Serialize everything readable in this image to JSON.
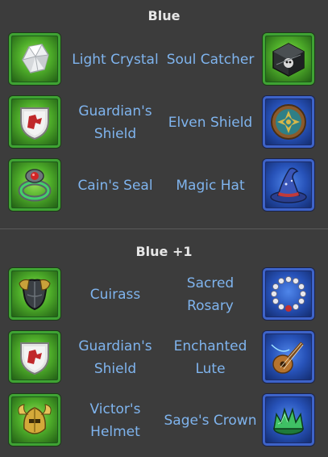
{
  "sections": [
    {
      "title": "Blue",
      "rows": [
        {
          "left": {
            "name": "Light Crystal",
            "icon": "light-crystal-icon",
            "rarity": "green"
          },
          "right": {
            "name": "Soul Catcher",
            "icon": "soul-catcher-icon",
            "rarity": "green"
          }
        },
        {
          "left": {
            "name": "Guardian's\nShield",
            "icon": "guardians-shield-icon",
            "rarity": "green"
          },
          "right": {
            "name": "Elven Shield",
            "icon": "elven-shield-icon",
            "rarity": "blue"
          }
        },
        {
          "left": {
            "name": "Cain's Seal",
            "icon": "cains-seal-icon",
            "rarity": "green"
          },
          "right": {
            "name": "Magic Hat",
            "icon": "magic-hat-icon",
            "rarity": "blue"
          }
        }
      ]
    },
    {
      "title": "Blue +1",
      "rows": [
        {
          "left": {
            "name": "Cuirass",
            "icon": "cuirass-icon",
            "rarity": "green"
          },
          "right": {
            "name": "Sacred\nRosary",
            "icon": "sacred-rosary-icon",
            "rarity": "blue"
          }
        },
        {
          "left": {
            "name": "Guardian's\nShield",
            "icon": "guardians-shield-icon",
            "rarity": "green"
          },
          "right": {
            "name": "Enchanted\nLute",
            "icon": "enchanted-lute-icon",
            "rarity": "blue"
          }
        },
        {
          "left": {
            "name": "Victor's\nHelmet",
            "icon": "victors-helmet-icon",
            "rarity": "green"
          },
          "right": {
            "name": "Sage's Crown",
            "icon": "sages-crown-icon",
            "rarity": "blue"
          }
        }
      ]
    }
  ],
  "colors": {
    "background": "#3c3c3c",
    "title": "#e6e6e6",
    "item_name": "#7fb4ee",
    "frame_green": "#3fa333",
    "frame_blue": "#3d63c9"
  }
}
